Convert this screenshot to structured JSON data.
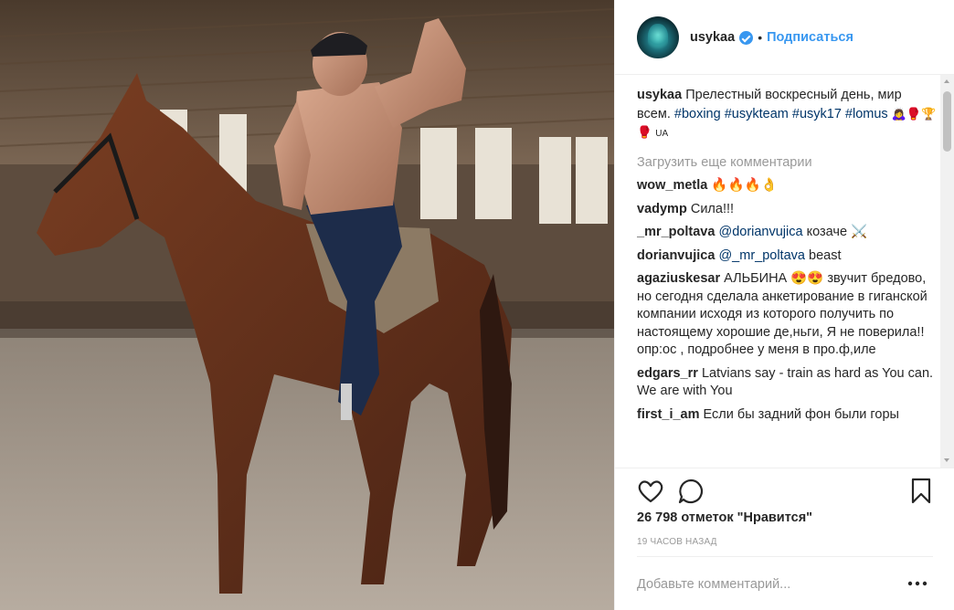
{
  "photo": {
    "description_icon": "riding-photo"
  },
  "header": {
    "username": "usykaa",
    "separator": "•",
    "follow_label": "Подписаться"
  },
  "caption": {
    "username": "usykaa",
    "text": "Прелестный воскресный день, мир всем.",
    "tags": [
      "#boxing",
      "#usykteam",
      "#usyk17",
      "#lomus"
    ],
    "emojis": "🙇‍♀️🥊🏆🥊",
    "badge": "UA"
  },
  "load_more_label": "Загрузить еще комментарии",
  "comments": [
    {
      "username": "wow_metla",
      "text": "🔥🔥🔥👌"
    },
    {
      "username": "vadymp",
      "text": "Сила!!!"
    },
    {
      "username": "_mr_poltava",
      "mention": "@dorianvujica",
      "text": "козаче ⚔️"
    },
    {
      "username": "dorianvujica",
      "mention": "@_mr_poltava",
      "text": "beast"
    },
    {
      "username": "agaziuskesar",
      "text": "АЛЬБИНА 😍😍 звучит бредово, но сегодня сделала анкетирование в гиганской компании исходя из которого получить по настоящему хорошие де,ньги, Я не поверила!! опр:ос , подробнее у меня в про.ф,иле"
    },
    {
      "username": "edgars_rr",
      "text": "Latvians say - train as hard as You can. We are with You"
    },
    {
      "username": "first_i_am",
      "text": "Если бы задний фон были горы"
    }
  ],
  "actions": {
    "like_icon": "heart-icon",
    "comment_icon": "comment-icon",
    "save_icon": "bookmark-icon"
  },
  "likes_text": "26 798 отметок \"Нравится\"",
  "timestamp": "19 ЧАСОВ НАЗАД",
  "add_comment": {
    "placeholder": "Добавьте комментарий...",
    "more_icon": "more-options-icon"
  },
  "colors": {
    "link": "#003569",
    "follow": "#3897f0",
    "muted": "#999999",
    "text": "#262626"
  }
}
